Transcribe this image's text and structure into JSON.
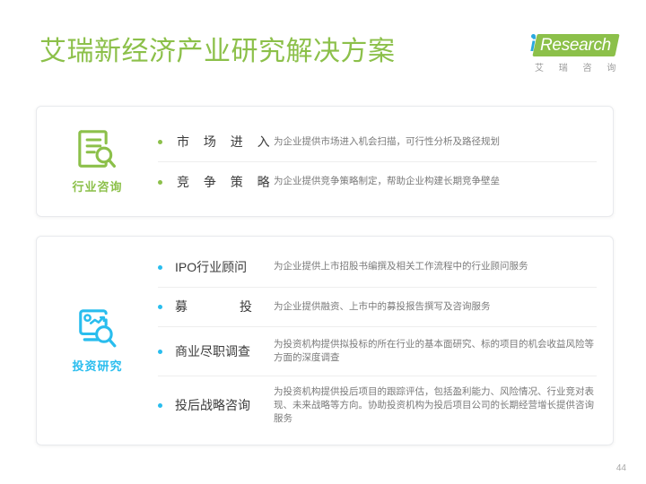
{
  "header": {
    "title": "艾瑞新经济产业研究解决方案",
    "title_color": "#8cc04a"
  },
  "logo": {
    "i": "i",
    "word": "Research",
    "sub": "艾 瑞 咨 询",
    "shape_color": "#8cc04a",
    "i_color": "#2aa9df"
  },
  "cards": [
    {
      "id": "industry-consulting",
      "icon_name": "document-search-icon",
      "icon_color": "#8cc04a",
      "label": "行业咨询",
      "rows": [
        {
          "title": "市 场 进 入",
          "desc": "为企业提供市场进入机会扫描，可行性分析及路径规划"
        },
        {
          "title": "竞 争 策 略",
          "desc": "为企业提供竞争策略制定，帮助企业构建长期竞争壁垒"
        }
      ]
    },
    {
      "id": "investment-research",
      "icon_name": "chart-monitor-search-icon",
      "icon_color": "#29bdee",
      "label": "投资研究",
      "rows": [
        {
          "title": "IPO行业顾问",
          "desc": "为企业提供上市招股书编撰及相关工作流程中的行业顾问服务"
        },
        {
          "title_a": "募",
          "title_b": "投",
          "desc": "为企业提供融资、上市中的募投报告撰写及咨询服务"
        },
        {
          "title": "商业尽职调查",
          "desc": "为投资机构提供拟投标的所在行业的基本面研究、标的项目的机会收益风险等方面的深度调查"
        },
        {
          "title": "投后战略咨询",
          "desc": "为投资机构提供投后项目的跟踪评估，包括盈利能力、风险情况、行业竞对表现、未来战略等方向。协助投资机构为投后项目公司的长期经营增长提供咨询服务"
        }
      ]
    }
  ],
  "footer": {
    "page_number": "44"
  }
}
